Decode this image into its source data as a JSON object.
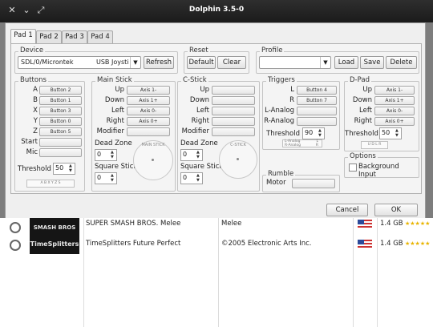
{
  "window": {
    "title": "Dolphin 3.5-0",
    "controls": [
      "menu",
      "minimize",
      "maximize"
    ]
  },
  "tabs": [
    {
      "label": "Pad 1",
      "active": true
    },
    {
      "label": "Pad 2"
    },
    {
      "label": "Pad 3"
    },
    {
      "label": "Pad 4"
    }
  ],
  "device": {
    "group": "Device",
    "value": "SDL/0/Microntek",
    "selector": "USB Joysti",
    "refresh": "Refresh"
  },
  "reset": {
    "group": "Reset",
    "default": "Default",
    "clear": "Clear"
  },
  "profile": {
    "group": "Profile",
    "value": "",
    "load": "Load",
    "save": "Save",
    "delete": "Delete"
  },
  "buttons": {
    "group": "Buttons",
    "rows": [
      {
        "label": "A",
        "mapping": "Button 2"
      },
      {
        "label": "B",
        "mapping": "Button 1"
      },
      {
        "label": "X",
        "mapping": "Button 3"
      },
      {
        "label": "Y",
        "mapping": "Button 0"
      },
      {
        "label": "Z",
        "mapping": "Button 5"
      },
      {
        "label": "Start",
        "mapping": ""
      },
      {
        "label": "Mic",
        "mapping": ""
      }
    ],
    "threshold_label": "Threshold",
    "threshold_value": "50",
    "indicator": "A B X Y Z S"
  },
  "main_stick": {
    "group": "Main Stick",
    "rows": [
      {
        "label": "Up",
        "mapping": "Axis 1-"
      },
      {
        "label": "Down",
        "mapping": "Axis 1+"
      },
      {
        "label": "Left",
        "mapping": "Axis 0-"
      },
      {
        "label": "Right",
        "mapping": "Axis 0+"
      },
      {
        "label": "Modifier",
        "mapping": ""
      }
    ],
    "dead_zone_label": "Dead Zone",
    "dead_zone_value": "0",
    "square_label": "Square Stick",
    "square_value": "0",
    "preview": "MAIN STICK"
  },
  "c_stick": {
    "group": "C-Stick",
    "rows": [
      {
        "label": "Up",
        "mapping": ""
      },
      {
        "label": "Down",
        "mapping": ""
      },
      {
        "label": "Left",
        "mapping": ""
      },
      {
        "label": "Right",
        "mapping": ""
      },
      {
        "label": "Modifier",
        "mapping": ""
      }
    ],
    "dead_zone_label": "Dead Zone",
    "dead_zone_value": "0",
    "square_label": "Square Stick",
    "square_value": "0",
    "preview": "C-STICK"
  },
  "triggers": {
    "group": "Triggers",
    "rows": [
      {
        "label": "L",
        "mapping": "Button 4"
      },
      {
        "label": "R",
        "mapping": "Button 7"
      },
      {
        "label": "L-Analog",
        "mapping": ""
      },
      {
        "label": "R-Analog",
        "mapping": ""
      }
    ],
    "threshold_label": "Threshold",
    "threshold_value": "90",
    "indicators": [
      "L-Analog",
      "R-Analog"
    ],
    "indicator_flags": [
      "L",
      "R"
    ]
  },
  "dpad": {
    "group": "D-Pad",
    "rows": [
      {
        "label": "Up",
        "mapping": "Axis 1-"
      },
      {
        "label": "Down",
        "mapping": "Axis 1+"
      },
      {
        "label": "Left",
        "mapping": "Axis 0-"
      },
      {
        "label": "Right",
        "mapping": "Axis 0+"
      }
    ],
    "threshold_label": "Threshold",
    "threshold_value": "50",
    "indicator": "U D L R"
  },
  "rumble": {
    "group": "Rumble",
    "motor_label": "Motor",
    "motor_value": ""
  },
  "options": {
    "group": "Options",
    "background_input": "Background Input",
    "checked": false
  },
  "footer": {
    "cancel": "Cancel",
    "ok": "OK"
  },
  "games": [
    {
      "cover": "SMASH BROS",
      "title": "SUPER SMASH BROS. Melee",
      "maker": "Melee",
      "size": "1.4 GB",
      "rating": "★★★★★"
    },
    {
      "cover": "TimeSplitters",
      "title": "TimeSplitters Future Perfect",
      "maker": "©2005 Electronic Arts Inc.",
      "size": "1.4 GB",
      "rating": "★★★★★"
    }
  ],
  "colors": {
    "titlebar": "#1f1f1f",
    "dialog_bg": "#efefef",
    "desktop": "#7d7d7d"
  }
}
